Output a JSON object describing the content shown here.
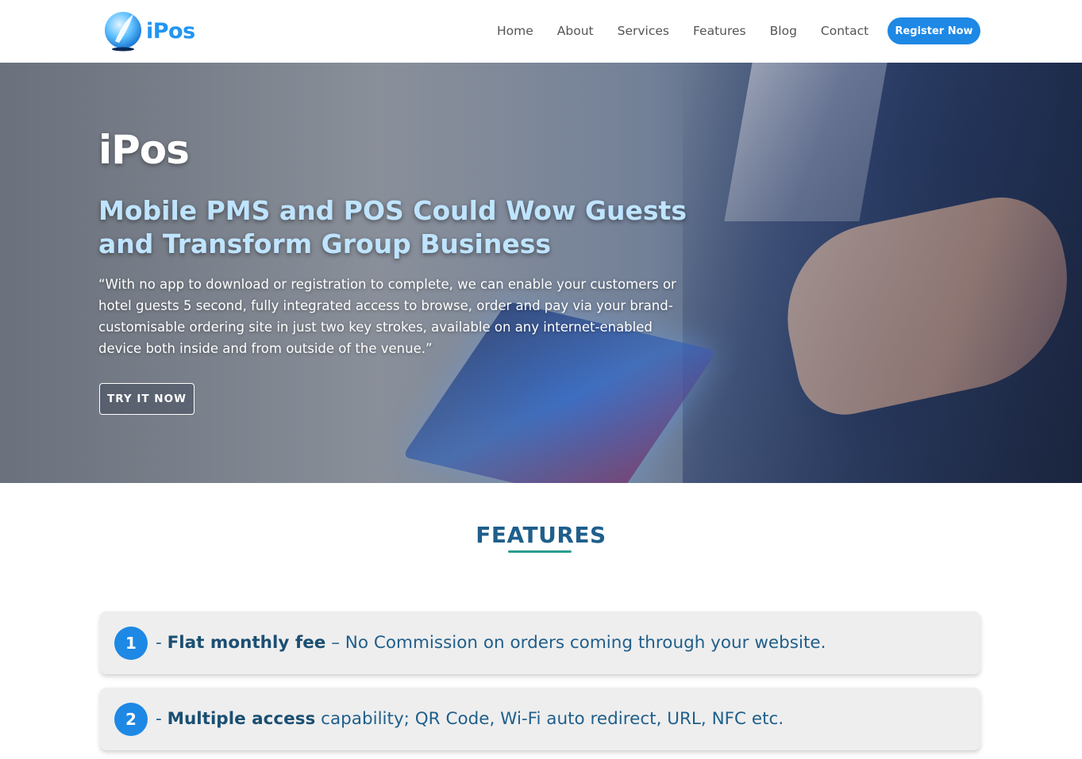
{
  "header": {
    "logo_text": "iPos",
    "nav": [
      "Home",
      "About",
      "Services",
      "Features",
      "Blog",
      "Contact"
    ],
    "register_label": "Register Now"
  },
  "hero": {
    "title": "iPos",
    "subtitle": "Mobile PMS and POS Could Wow Guests and Transform Group Business",
    "quote": "“With no app to download or registration to complete, we can enable your customers or hotel guests 5 second, fully integrated access to browse, order and pay via your brand-customisable ordering site in just two key strokes, available on any internet-enabled device both inside and from outside of the venue.”",
    "cta_label": "TRY IT NOW"
  },
  "features": {
    "heading": "FEATURES",
    "items": [
      {
        "number": "1",
        "prefix": "- ",
        "bold": "Flat monthly fee",
        "rest": " – No Commission on orders coming through your website."
      },
      {
        "number": "2",
        "prefix": "- ",
        "bold": "Multiple access",
        "rest": " capability; QR Code, Wi-Fi auto redirect, URL, NFC etc."
      }
    ]
  },
  "colors": {
    "brand": "#2196f3",
    "button": "#1e88e5",
    "heading": "#1f5f8b",
    "underline": "#2a9d8f"
  }
}
